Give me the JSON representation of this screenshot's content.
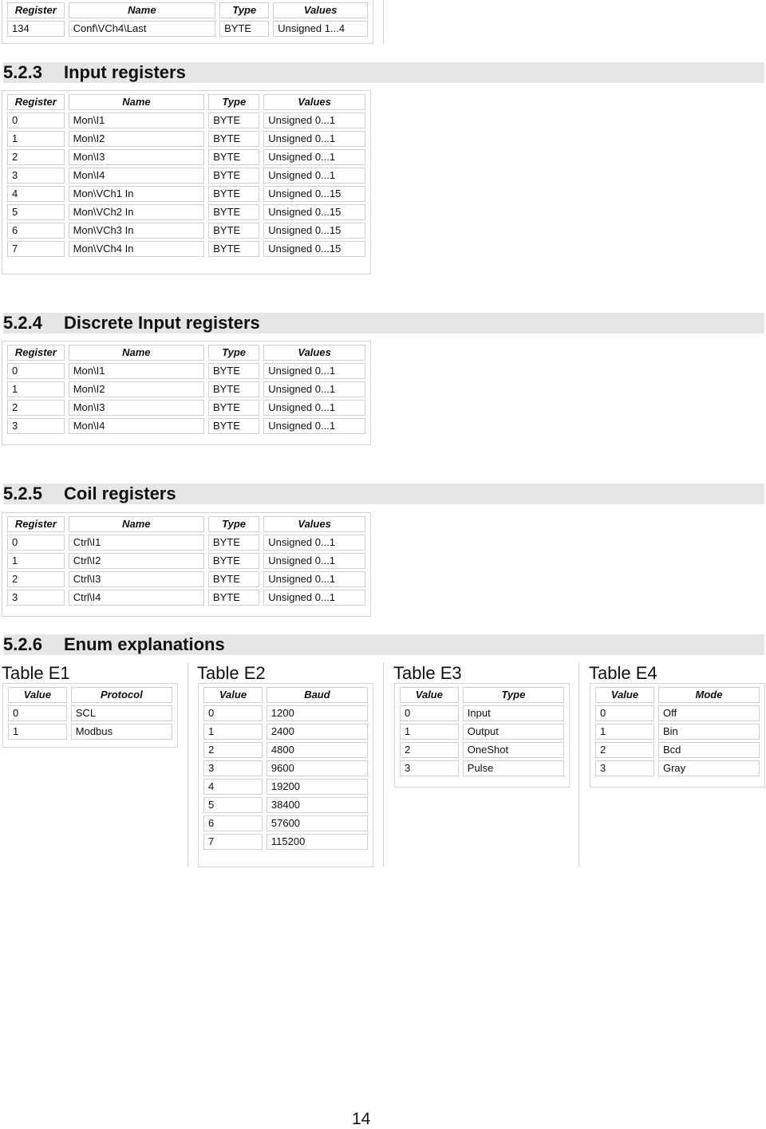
{
  "columns": {
    "register": "Register",
    "name": "Name",
    "type": "Type",
    "values": "Values"
  },
  "top_table": {
    "rows": [
      {
        "register": "134",
        "name": "Conf\\VCh4\\Last",
        "type": "BYTE",
        "values": "Unsigned 1...4"
      }
    ]
  },
  "sections": {
    "input": {
      "number": "5.2.3",
      "title": "Input registers",
      "rows": [
        {
          "register": "0",
          "name": "Mon\\I1",
          "type": "BYTE",
          "values": "Unsigned 0...1"
        },
        {
          "register": "1",
          "name": "Mon\\I2",
          "type": "BYTE",
          "values": "Unsigned 0...1"
        },
        {
          "register": "2",
          "name": "Mon\\I3",
          "type": "BYTE",
          "values": "Unsigned 0...1"
        },
        {
          "register": "3",
          "name": "Mon\\I4",
          "type": "BYTE",
          "values": "Unsigned 0...1"
        },
        {
          "register": "4",
          "name": "Mon\\VCh1 In",
          "type": "BYTE",
          "values": "Unsigned 0...15"
        },
        {
          "register": "5",
          "name": "Mon\\VCh2 In",
          "type": "BYTE",
          "values": "Unsigned 0...15"
        },
        {
          "register": "6",
          "name": "Mon\\VCh3 In",
          "type": "BYTE",
          "values": "Unsigned 0...15"
        },
        {
          "register": "7",
          "name": "Mon\\VCh4 In",
          "type": "BYTE",
          "values": "Unsigned 0...15"
        }
      ]
    },
    "discrete": {
      "number": "5.2.4",
      "title": "Discrete Input registers",
      "rows": [
        {
          "register": "0",
          "name": "Mon\\I1",
          "type": "BYTE",
          "values": "Unsigned 0...1"
        },
        {
          "register": "1",
          "name": "Mon\\I2",
          "type": "BYTE",
          "values": "Unsigned 0...1"
        },
        {
          "register": "2",
          "name": "Mon\\I3",
          "type": "BYTE",
          "values": "Unsigned 0...1"
        },
        {
          "register": "3",
          "name": "Mon\\I4",
          "type": "BYTE",
          "values": "Unsigned 0...1"
        }
      ]
    },
    "coil": {
      "number": "5.2.5",
      "title": "Coil registers",
      "rows": [
        {
          "register": "0",
          "name": "Ctrl\\I1",
          "type": "BYTE",
          "values": "Unsigned 0...1"
        },
        {
          "register": "1",
          "name": "Ctrl\\I2",
          "type": "BYTE",
          "values": "Unsigned 0...1"
        },
        {
          "register": "2",
          "name": "Ctrl\\I3",
          "type": "BYTE",
          "values": "Unsigned 0...1"
        },
        {
          "register": "3",
          "name": "Ctrl\\I4",
          "type": "BYTE",
          "values": "Unsigned 0...1"
        }
      ]
    },
    "enum": {
      "number": "5.2.6",
      "title": "Enum explanations",
      "tables": [
        {
          "title": "Table E1",
          "col_value": "Value",
          "col_name": "Protocol",
          "rows": [
            {
              "value": "0",
              "name": "SCL"
            },
            {
              "value": "1",
              "name": "Modbus"
            }
          ]
        },
        {
          "title": "Table E2",
          "col_value": "Value",
          "col_name": "Baud",
          "rows": [
            {
              "value": "0",
              "name": "1200"
            },
            {
              "value": "1",
              "name": "2400"
            },
            {
              "value": "2",
              "name": "4800"
            },
            {
              "value": "3",
              "name": "9600"
            },
            {
              "value": "4",
              "name": "19200"
            },
            {
              "value": "5",
              "name": "38400"
            },
            {
              "value": "6",
              "name": "57600"
            },
            {
              "value": "7",
              "name": "115200"
            }
          ]
        },
        {
          "title": "Table E3",
          "col_value": "Value",
          "col_name": "Type",
          "rows": [
            {
              "value": "0",
              "name": "Input"
            },
            {
              "value": "1",
              "name": "Output"
            },
            {
              "value": "2",
              "name": "OneShot"
            },
            {
              "value": "3",
              "name": "Pulse"
            }
          ]
        },
        {
          "title": "Table E4",
          "col_value": "Value",
          "col_name": "Mode",
          "rows": [
            {
              "value": "0",
              "name": "Off"
            },
            {
              "value": "1",
              "name": "Bin"
            },
            {
              "value": "2",
              "name": "Bcd"
            },
            {
              "value": "3",
              "name": "Gray"
            }
          ]
        }
      ]
    }
  },
  "page_number": "14",
  "colors": {
    "section_band": "#e6e6e6",
    "cell_border": "#cfcfcf",
    "text": "#111111"
  }
}
